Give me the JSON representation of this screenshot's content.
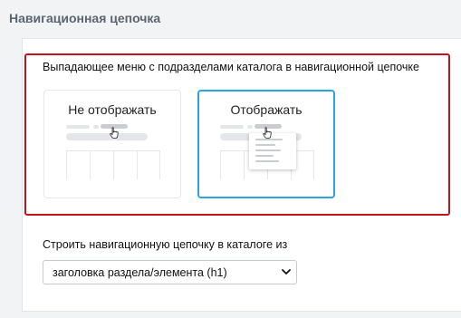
{
  "section": {
    "title": "Навигационная цепочка"
  },
  "option": {
    "label": "Выпадающее меню с подразделами каталога в навигационной цепочке",
    "cards": [
      {
        "label": "Не отображать",
        "selected": false
      },
      {
        "label": "Отображать",
        "selected": true
      }
    ],
    "highlight_color": "#c4121f",
    "selected_color": "#2aa3e3"
  },
  "breadcrumb_source": {
    "label": "Строить навигационную цепочку в каталоге из",
    "selected_value": "заголовка раздела/элемента (h1)"
  },
  "icons": [
    "hand-pointer-icon",
    "chevron-down-icon"
  ]
}
